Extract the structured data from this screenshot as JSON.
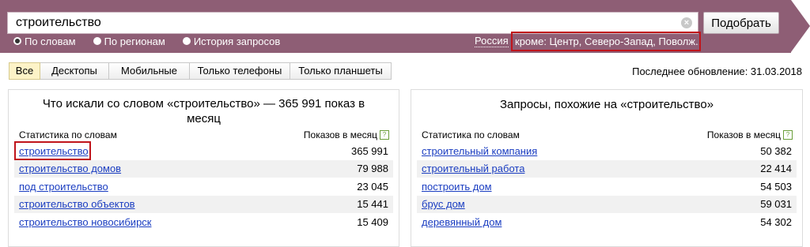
{
  "search": {
    "query": "строительство",
    "clear_icon": "×",
    "submit_label": "Подобрать"
  },
  "modes": [
    {
      "label": "По словам",
      "checked": true
    },
    {
      "label": "По регионам",
      "checked": false
    },
    {
      "label": "История запросов",
      "checked": false
    }
  ],
  "region": {
    "label": "Россия",
    "value": "кроме: Центр, Северо-Запад, Поволж..."
  },
  "tabs": [
    {
      "label": "Все",
      "active": true
    },
    {
      "label": "Десктопы",
      "active": false
    },
    {
      "label": "Мобильные",
      "active": false
    },
    {
      "label": "Только телефоны",
      "active": false
    },
    {
      "label": "Только планшеты",
      "active": false
    }
  ],
  "last_update": "Последнее обновление: 31.03.2018",
  "left_panel": {
    "title": "Что искали со словом «строительство» — 365 991 показ в месяц",
    "col_words": "Статистика по словам",
    "col_shows": "Показов в месяц",
    "help_icon": "?",
    "rows": [
      {
        "phrase": "строительство",
        "count": "365 991"
      },
      {
        "phrase": "строительство домов",
        "count": "79 988"
      },
      {
        "phrase": "под строительство",
        "count": "23 045"
      },
      {
        "phrase": "строительство объектов",
        "count": "15 441"
      },
      {
        "phrase": "строительство новосибирск",
        "count": "15 409"
      }
    ]
  },
  "right_panel": {
    "title": "Запросы, похожие на «строительство»",
    "col_words": "Статистика по словам",
    "col_shows": "Показов в месяц",
    "help_icon": "?",
    "rows": [
      {
        "phrase": "строительный компания",
        "count": "50 382"
      },
      {
        "phrase": "строительный работа",
        "count": "22 414"
      },
      {
        "phrase": "построить дом",
        "count": "54 503"
      },
      {
        "phrase": "брус дом",
        "count": "59 031"
      },
      {
        "phrase": "деревянный дом",
        "count": "54 302"
      }
    ]
  },
  "colors": {
    "band": "#8e5e75",
    "highlight": "#c0141b",
    "link": "#1a3dc1",
    "active_tab": "#fdf3c7"
  }
}
